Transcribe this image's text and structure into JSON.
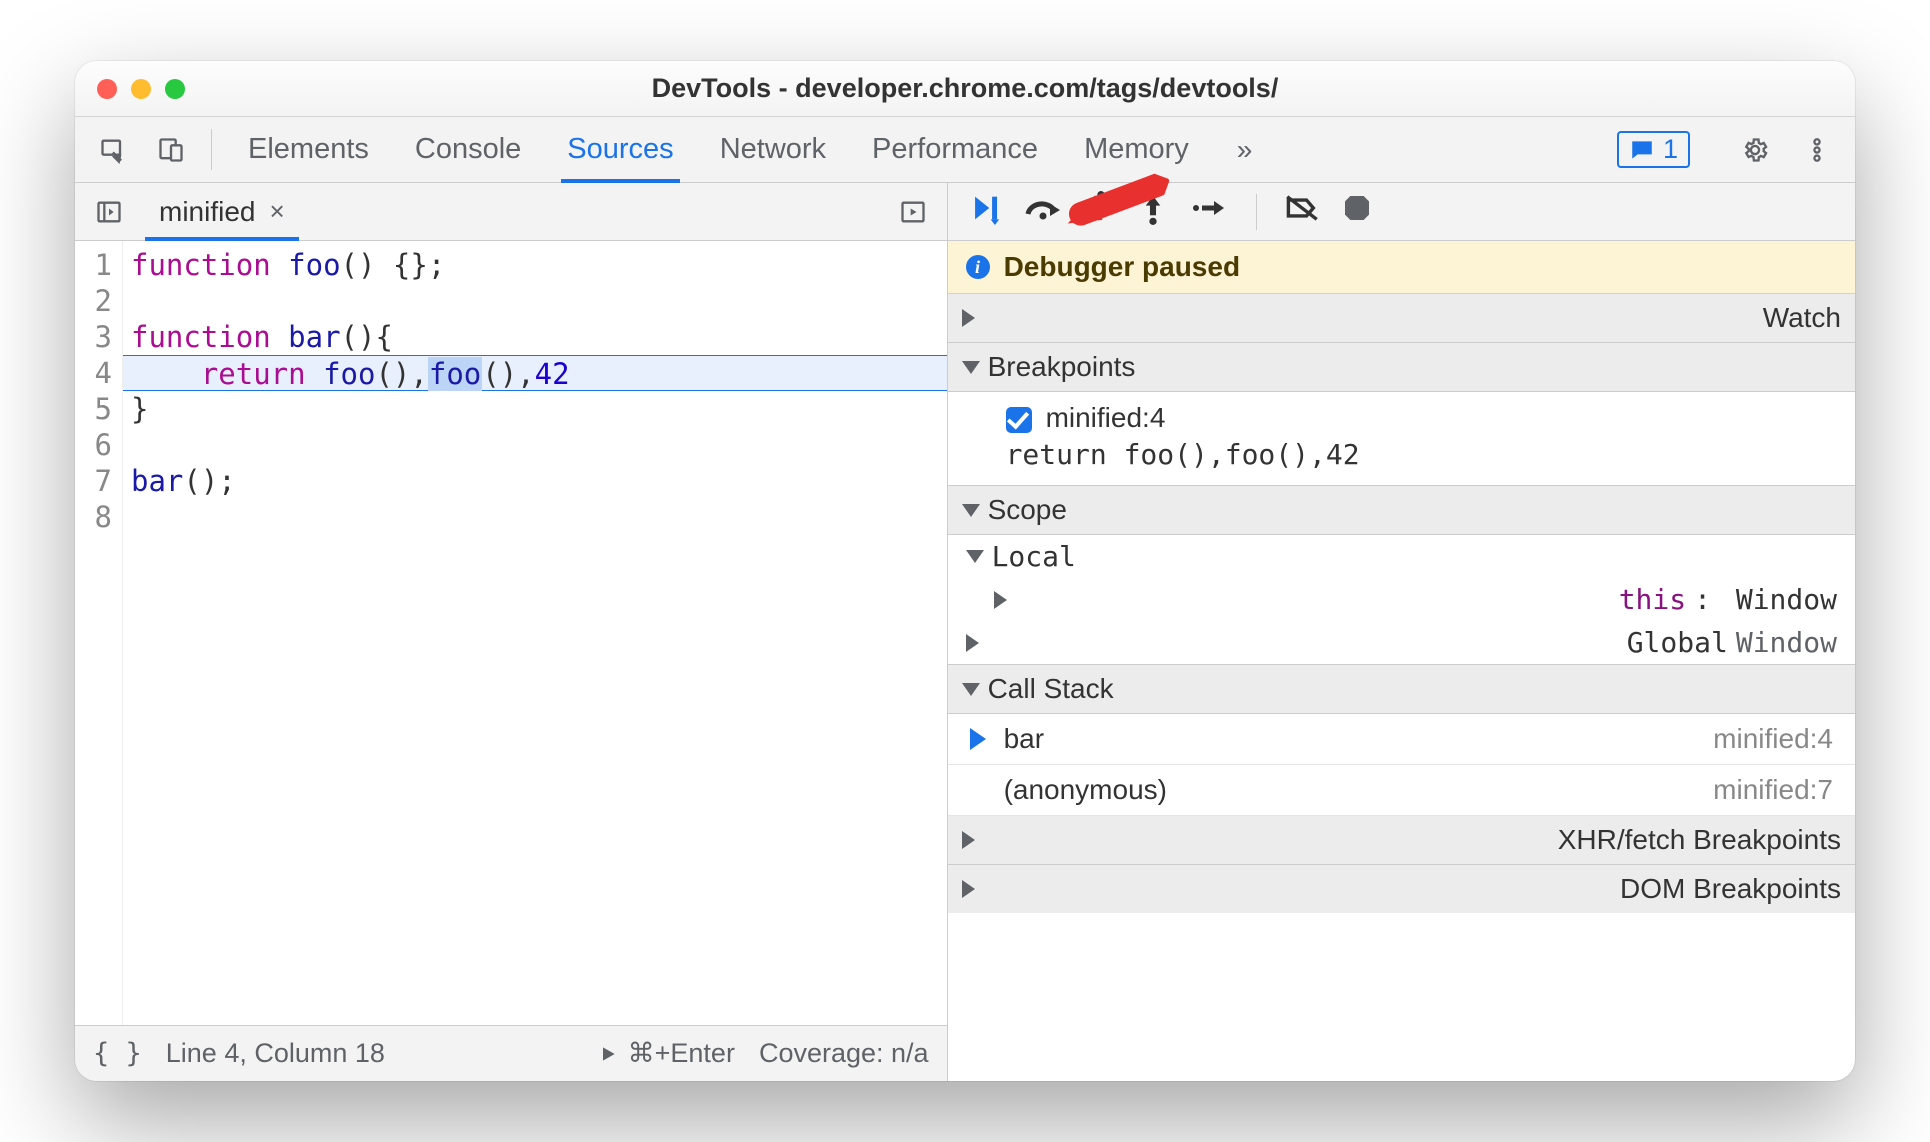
{
  "window_title": "DevTools - developer.chrome.com/tags/devtools/",
  "tabs": [
    "Elements",
    "Console",
    "Sources",
    "Network",
    "Performance",
    "Memory"
  ],
  "active_tab": "Sources",
  "message_count": "1",
  "source": {
    "filename": "minified",
    "lines_numbers": [
      "1",
      "2",
      "3",
      "4",
      "5",
      "6",
      "7",
      "8"
    ],
    "code_lines": {
      "l1_kw": "function",
      "l1_fn": "foo",
      "l1_rest": "() {};",
      "l3_kw": "function",
      "l3_fn": "bar",
      "l3_rest": "(){",
      "l4_indent": "    ",
      "l4_kw": "return",
      "l4_fn1": "foo",
      "l4_mid1": "(),",
      "l4_fn2": "foo",
      "l4_mid2": "(),",
      "l4_num": "42",
      "l5": "}",
      "l7_fn": "bar",
      "l7_rest": "();"
    },
    "status_line_col": "Line 4, Column 18",
    "run_hint": "⌘+Enter",
    "coverage": "Coverage: n/a",
    "pretty_braces": "{ }"
  },
  "debugger": {
    "paused_text": "Debugger paused",
    "sections": {
      "watch": "Watch",
      "breakpoints": "Breakpoints",
      "scope": "Scope",
      "callstack": "Call Stack",
      "xhr": "XHR/fetch Breakpoints",
      "dom": "DOM Breakpoints"
    },
    "breakpoint": {
      "location": "minified:4",
      "code": "return foo(),foo(),42"
    },
    "scope": {
      "local": "Local",
      "this_label": "this",
      "this_value": "Window",
      "global": "Global",
      "global_value": "Window"
    },
    "callstack": [
      {
        "name": "bar",
        "loc": "minified:4",
        "current": true
      },
      {
        "name": "(anonymous)",
        "loc": "minified:7",
        "current": false
      }
    ]
  }
}
